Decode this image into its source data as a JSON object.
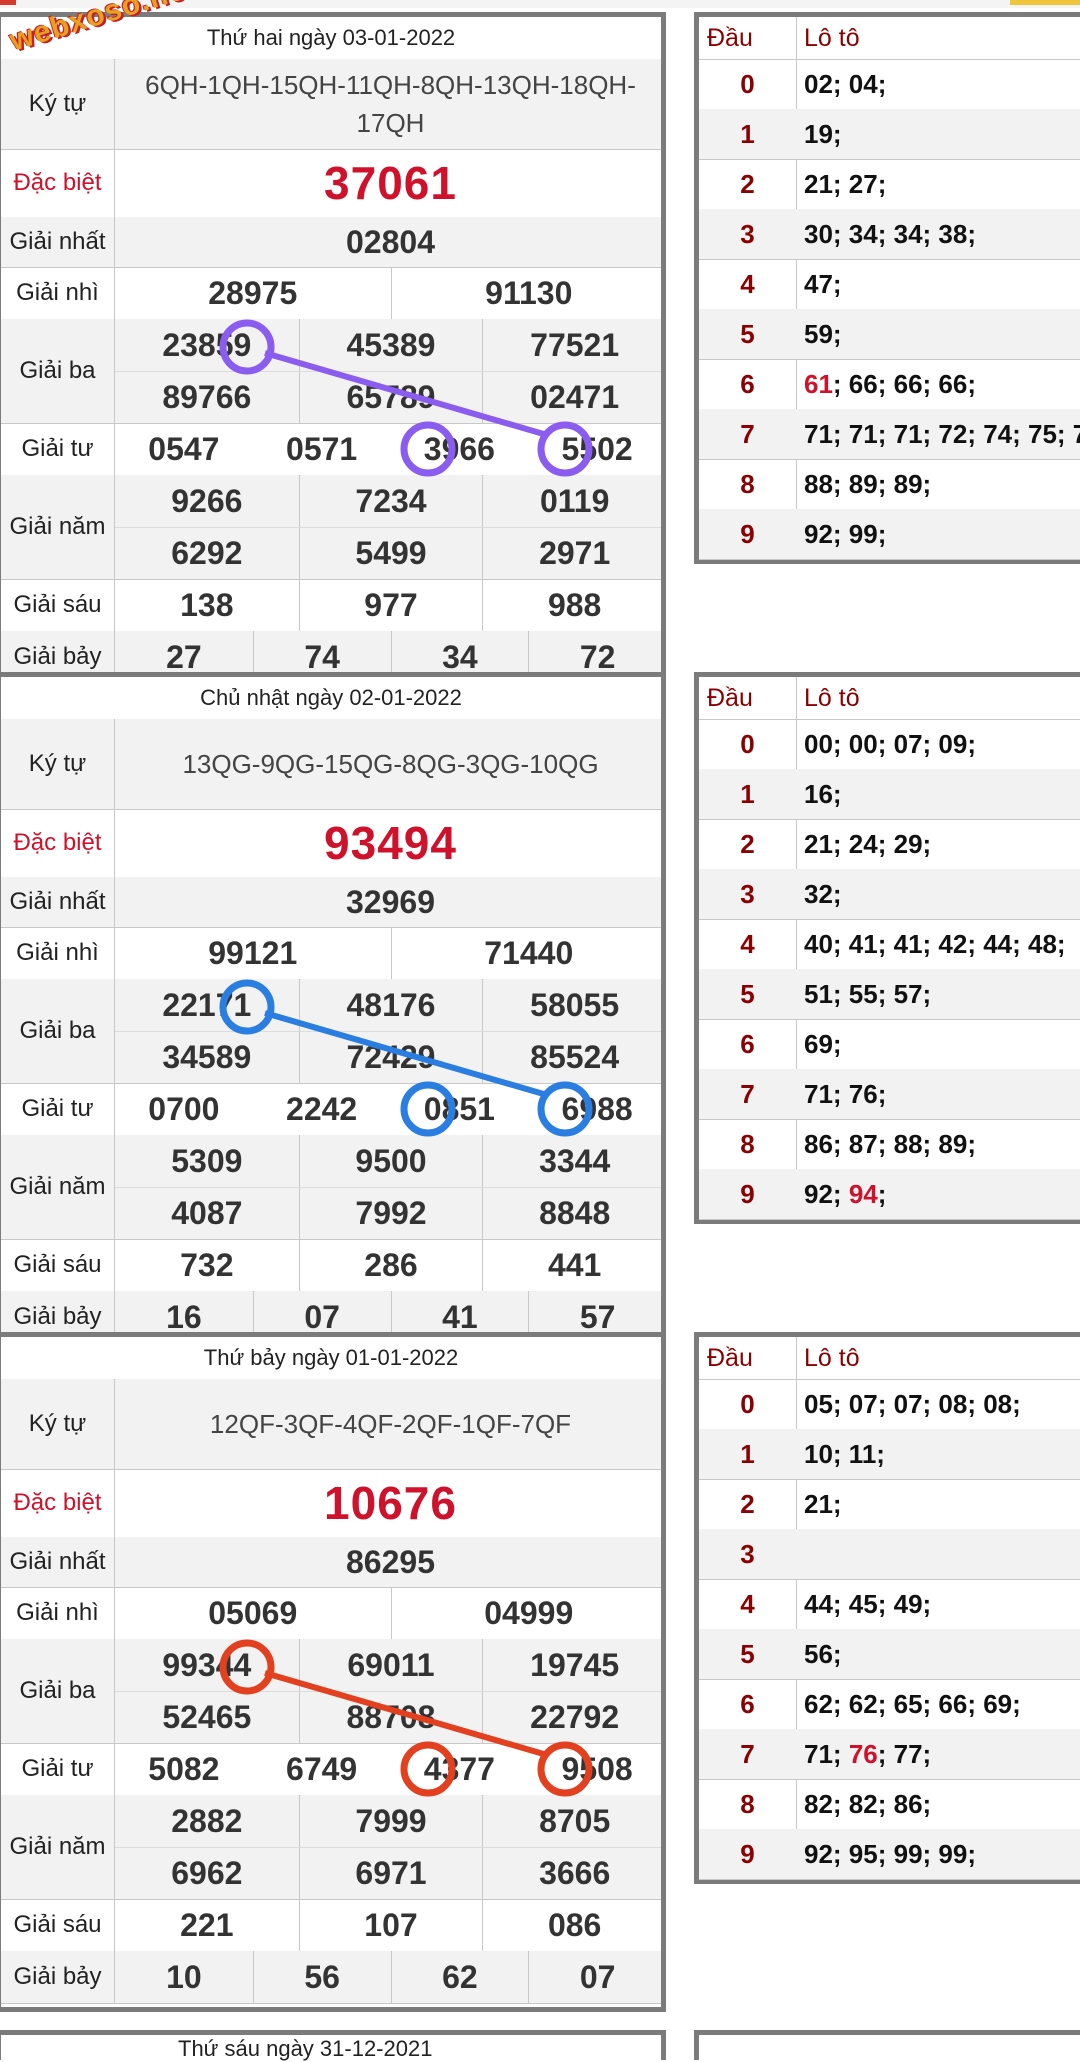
{
  "watermark": "webxoso.net",
  "labels": {
    "ky_tu": "Ký tự",
    "dac_biet": "Đặc biệt",
    "giai_nhat": "Giải nhất",
    "giai_nhi": "Giải nhì",
    "giai_ba": "Giải ba",
    "giai_tu": "Giải tư",
    "giai_nam": "Giải năm",
    "giai_sau": "Giải sáu",
    "giai_bay": "Giải bảy",
    "dau": "Đầu",
    "loto": "Lô tô"
  },
  "results": [
    {
      "header": "Thứ hai ngày 03-01-2022",
      "ky_tu": "6QH-1QH-15QH-11QH-8QH-13QH-18QH-17QH",
      "dac_biet": "37061",
      "giai_nhat": "02804",
      "giai_nhi": [
        "28975",
        "91130"
      ],
      "giai_ba": [
        "23859",
        "45389",
        "77521",
        "89766",
        "65789",
        "02471"
      ],
      "giai_tu": [
        "0547",
        "0571",
        "3966",
        "5502"
      ],
      "giai_nam": [
        "9266",
        "7234",
        "0119",
        "6292",
        "5499",
        "2971"
      ],
      "giai_sau": [
        "138",
        "977",
        "988"
      ],
      "giai_bay": [
        "27",
        "74",
        "34",
        "72"
      ],
      "loto": [
        {
          "d": "0",
          "n": "02; 04;"
        },
        {
          "d": "1",
          "n": "19;"
        },
        {
          "d": "2",
          "n": "21; 27;"
        },
        {
          "d": "3",
          "n": "30; 34; 34; 38;"
        },
        {
          "d": "4",
          "n": "47;"
        },
        {
          "d": "5",
          "n": "59;"
        },
        {
          "d": "6",
          "hl": "61",
          "n": "; 66; 66; 66;"
        },
        {
          "d": "7",
          "n": "71; 71; 71; 72; 74; 75; 7"
        },
        {
          "d": "8",
          "n": "88; 89; 89;"
        },
        {
          "d": "9",
          "n": "92; 99;"
        }
      ],
      "pattern_color": "#8a5cf0"
    },
    {
      "header": "Chủ nhật ngày 02-01-2022",
      "ky_tu": "13QG-9QG-15QG-8QG-3QG-10QG",
      "dac_biet": "93494",
      "giai_nhat": "32969",
      "giai_nhi": [
        "99121",
        "71440"
      ],
      "giai_ba": [
        "22171",
        "48176",
        "58055",
        "34589",
        "72429",
        "85524"
      ],
      "giai_tu": [
        "0700",
        "2242",
        "0851",
        "6988"
      ],
      "giai_nam": [
        "5309",
        "9500",
        "3344",
        "4087",
        "7992",
        "8848"
      ],
      "giai_sau": [
        "732",
        "286",
        "441"
      ],
      "giai_bay": [
        "16",
        "07",
        "41",
        "57"
      ],
      "loto": [
        {
          "d": "0",
          "n": "00; 00; 07; 09;"
        },
        {
          "d": "1",
          "n": "16;"
        },
        {
          "d": "2",
          "n": "21; 24; 29;"
        },
        {
          "d": "3",
          "n": "32;"
        },
        {
          "d": "4",
          "n": "40; 41; 41; 42; 44; 48;"
        },
        {
          "d": "5",
          "n": "51; 55; 57;"
        },
        {
          "d": "6",
          "n": "69;"
        },
        {
          "d": "7",
          "n": "71; 76;"
        },
        {
          "d": "8",
          "n": "86; 87; 88; 89;"
        },
        {
          "d": "9",
          "pre": "92; ",
          "hl": "94",
          "n": ";"
        }
      ],
      "pattern_color": "#2a7de1"
    },
    {
      "header": "Thứ bảy ngày 01-01-2022",
      "ky_tu": "12QF-3QF-4QF-2QF-1QF-7QF",
      "dac_biet": "10676",
      "giai_nhat": "86295",
      "giai_nhi": [
        "05069",
        "04999"
      ],
      "giai_ba": [
        "99344",
        "69011",
        "19745",
        "52465",
        "88708",
        "22792"
      ],
      "giai_tu": [
        "5082",
        "6749",
        "4377",
        "9508"
      ],
      "giai_nam": [
        "2882",
        "7999",
        "8705",
        "6962",
        "6971",
        "3666"
      ],
      "giai_sau": [
        "221",
        "107",
        "086"
      ],
      "giai_bay": [
        "10",
        "56",
        "62",
        "07"
      ],
      "loto": [
        {
          "d": "0",
          "n": "05; 07; 07; 08; 08;"
        },
        {
          "d": "1",
          "n": "10; 11;"
        },
        {
          "d": "2",
          "n": "21;"
        },
        {
          "d": "3",
          "n": ""
        },
        {
          "d": "4",
          "n": "44; 45; 49;"
        },
        {
          "d": "5",
          "n": "56;"
        },
        {
          "d": "6",
          "n": "62; 62; 65; 66; 69;"
        },
        {
          "d": "7",
          "pre": "71; ",
          "hl": "76",
          "n": "; 77;"
        },
        {
          "d": "8",
          "n": "82; 82; 86;"
        },
        {
          "d": "9",
          "n": "92; 95; 99; 99;"
        }
      ],
      "pattern_color": "#e2401f"
    }
  ],
  "next_header": "Thứ sáu ngày 31-12-2021"
}
